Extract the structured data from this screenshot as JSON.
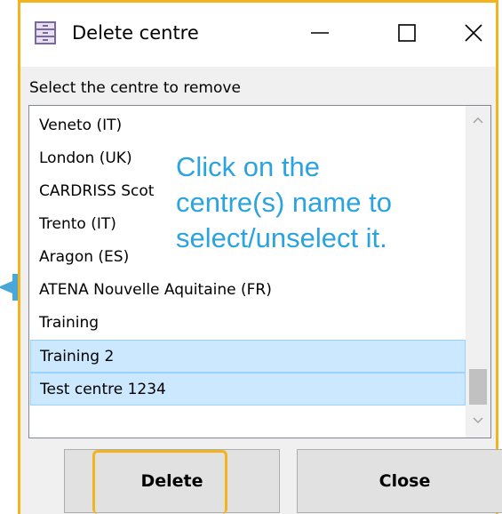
{
  "window": {
    "title": "Delete centre",
    "app_icon": "cabinet-icon",
    "controls": [
      "minimize-icon",
      "maximize-icon",
      "close-icon"
    ]
  },
  "prompt": "Select the centre to remove",
  "list": {
    "items": [
      {
        "label": "Veneto (IT)",
        "selected": false
      },
      {
        "label": "London (UK)",
        "selected": false
      },
      {
        "label": "CARDRISS Scot",
        "selected": false
      },
      {
        "label": "Trento (IT)",
        "selected": false
      },
      {
        "label": "Aragon (ES)",
        "selected": false
      },
      {
        "label": "ATENA Nouvelle Aquitaine (FR)",
        "selected": false
      },
      {
        "label": "Training",
        "selected": false
      },
      {
        "label": "Training 2",
        "selected": true
      },
      {
        "label": "Test centre 1234",
        "selected": true
      }
    ]
  },
  "hint": {
    "lines": [
      "Click on the",
      "centre(s) name to",
      "select/unselect it."
    ],
    "color": "#2aa3df"
  },
  "buttons": {
    "delete_label": "Delete",
    "close_label": "Close"
  },
  "highlight_color": "#f2b31d"
}
